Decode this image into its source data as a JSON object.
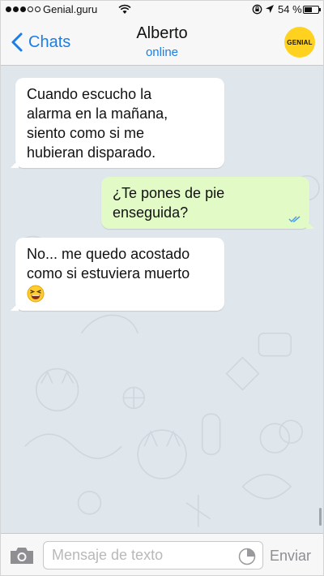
{
  "status_bar": {
    "carrier": "Genial.guru",
    "battery": "54 %"
  },
  "nav": {
    "back_label": "Chats",
    "title": "Alberto",
    "subtitle": "online",
    "avatar_text": "GENIAL"
  },
  "messages": [
    {
      "direction": "incoming",
      "lines": [
        "Cuando escucho la",
        "alarma en la mañana,",
        "siento como si me",
        "hubieran disparado."
      ]
    },
    {
      "direction": "outgoing",
      "lines": [
        "¿Te pones de pie",
        "enseguida?"
      ],
      "read": true
    },
    {
      "direction": "incoming",
      "lines": [
        "No... me quedo acostado",
        "como si estuviera muerto"
      ],
      "emoji": "laughing-face"
    }
  ],
  "input": {
    "placeholder": "Mensaje de texto",
    "value": "",
    "send_label": "Enviar"
  },
  "colors": {
    "accent": "#1a7ee6",
    "chat_background": "#dfe6ec",
    "outgoing_bubble": "#e2fbc6",
    "incoming_bubble": "#ffffff",
    "avatar": "#ffd21f"
  }
}
